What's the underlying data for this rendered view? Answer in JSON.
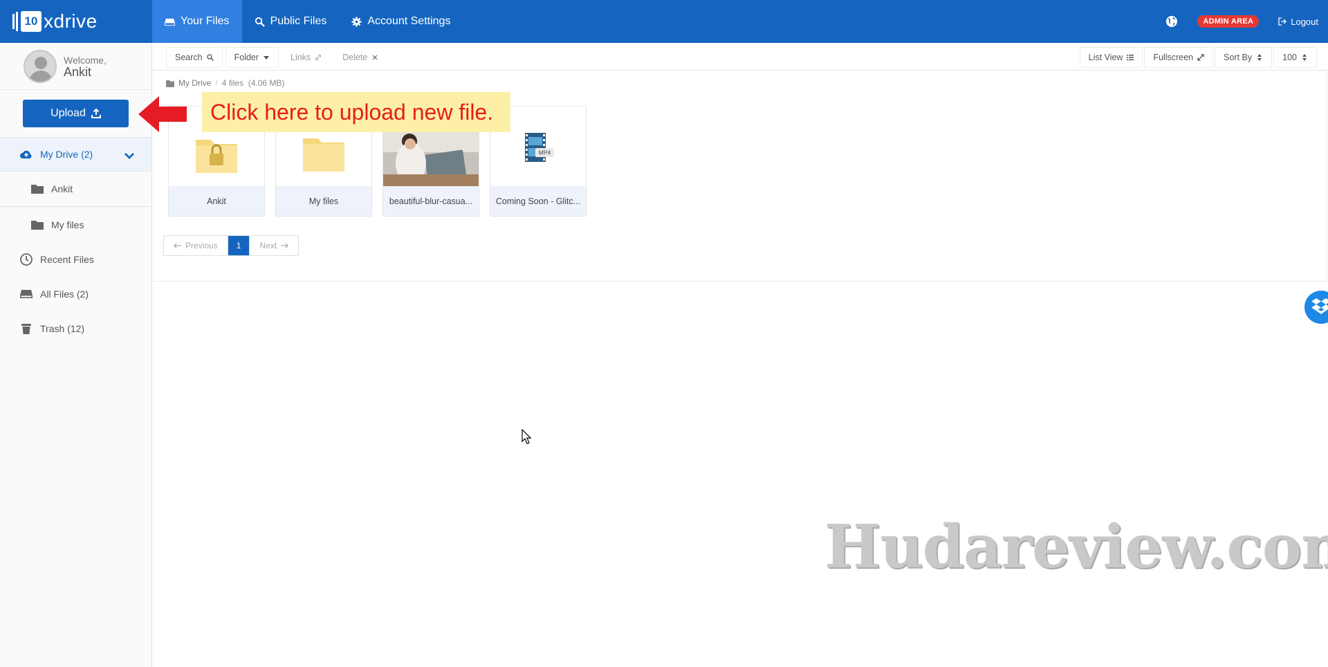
{
  "header": {
    "logo_number": "10",
    "logo_text": "xdrive",
    "nav": [
      {
        "label": "Your Files",
        "icon": "drive-icon",
        "active": true
      },
      {
        "label": "Public Files",
        "icon": "search-icon",
        "active": false
      },
      {
        "label": "Account Settings",
        "icon": "gear-icon",
        "active": false
      }
    ],
    "admin_label": "ADMIN AREA",
    "logout_label": "Logout"
  },
  "sidebar": {
    "welcome_label": "Welcome,",
    "user_name": "Ankit",
    "upload_label": "Upload",
    "items": [
      {
        "label": "My Drive (2)",
        "icon": "cloud-upload-icon"
      },
      {
        "label": "Ankit",
        "icon": "folder-icon"
      },
      {
        "label": "My files",
        "icon": "folder-icon"
      },
      {
        "label": "Recent Files",
        "icon": "clock-icon"
      },
      {
        "label": "All Files (2)",
        "icon": "drive-icon"
      },
      {
        "label": "Trash (12)",
        "icon": "trash-icon"
      }
    ]
  },
  "toolbar": {
    "search": "Search",
    "folder": "Folder",
    "links": "Links",
    "delete": "Delete",
    "list_view": "List View",
    "fullscreen": "Fullscreen",
    "sort_by": "Sort By",
    "per_page": "100"
  },
  "breadcrumb": {
    "root": "My Drive",
    "separator": "/",
    "summary": "4 files  (4.06 MB)"
  },
  "files": [
    {
      "name": "Ankit",
      "type": "locked-folder"
    },
    {
      "name": "My files",
      "type": "folder"
    },
    {
      "name": "beautiful-blur-casua...",
      "type": "image"
    },
    {
      "name": "Coming Soon - Glitc...",
      "type": "video",
      "badge": "MP4"
    }
  ],
  "pagination": {
    "previous": "Previous",
    "current": "1",
    "next": "Next"
  },
  "callout": {
    "text": "Click here to upload new file."
  },
  "watermark": "Hudareview.com",
  "colors": {
    "primary": "#1565c0",
    "nav_active": "#2f80e0",
    "admin_badge": "#e53935",
    "callout_bg": "#fdf0a6",
    "callout_text": "#e81c1c"
  }
}
